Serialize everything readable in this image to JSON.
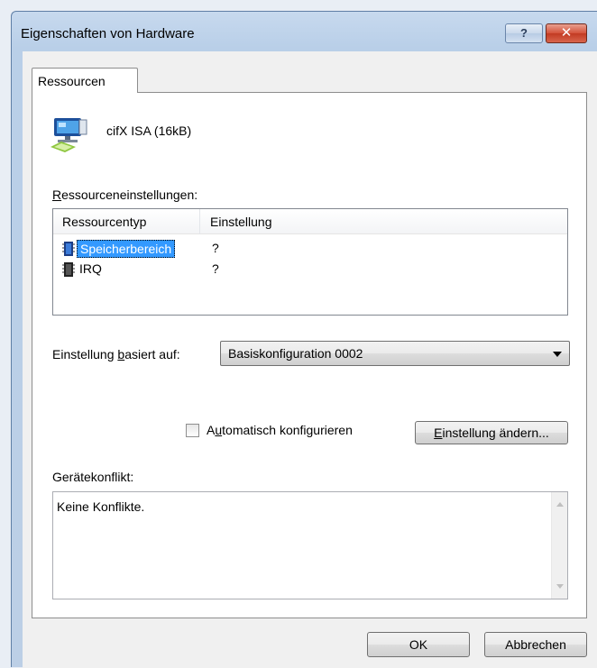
{
  "window": {
    "title": "Eigenschaften von Hardware",
    "help_glyph": "?",
    "close_glyph": "✕"
  },
  "tabs": [
    {
      "label": "Ressourcen",
      "selected": true
    }
  ],
  "device": {
    "name": "cifX ISA (16kB)",
    "icon": "network-adapter-icon"
  },
  "resources": {
    "label_prefix": "R",
    "label_rest": "essourceneinstellungen:",
    "columns": [
      "Ressourcentyp",
      "Einstellung"
    ],
    "rows": [
      {
        "type": "Speicherbereich",
        "setting": "?",
        "icon": "memory-chip-icon",
        "selected": true
      },
      {
        "type": "IRQ",
        "setting": "?",
        "icon": "irq-chip-icon",
        "selected": false
      }
    ]
  },
  "basis": {
    "label_a": "Einstellung ",
    "label_u": "b",
    "label_b": "asiert auf:",
    "selected_value": "Basiskonfiguration 0002"
  },
  "auto_config": {
    "label_a": "A",
    "label_u": "u",
    "label_b": "tomatisch konfigurieren",
    "checked": false
  },
  "change_button": {
    "label_u": "E",
    "label_b": "instellung ändern..."
  },
  "conflict": {
    "label": "Gerätekonflikt:",
    "text": "Keine Konflikte."
  },
  "buttons": {
    "ok": "OK",
    "cancel": "Abbrechen"
  }
}
